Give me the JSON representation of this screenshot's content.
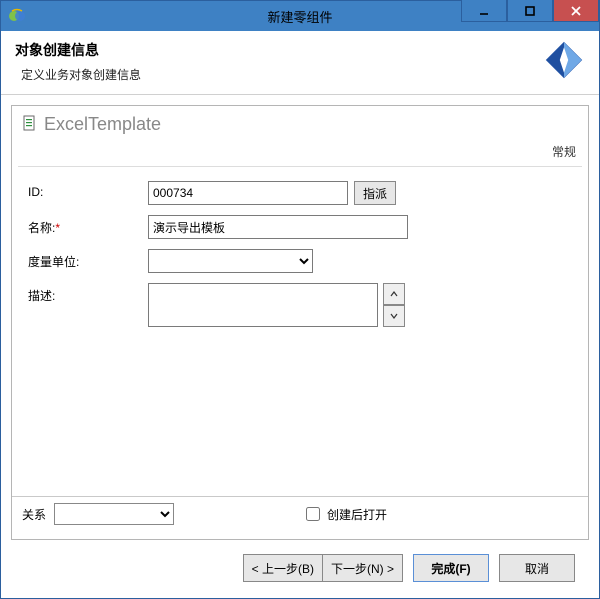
{
  "window": {
    "title": "新建零组件"
  },
  "header": {
    "title": "对象创建信息",
    "subtitle": "定义业务对象创建信息"
  },
  "panel": {
    "title": "ExcelTemplate",
    "tab": "常规"
  },
  "form": {
    "id": {
      "label": "ID:",
      "value": "000734",
      "assign_btn": "指派"
    },
    "name": {
      "label": "名称:",
      "value": "演示导出模板"
    },
    "unit": {
      "label": "度量单位:",
      "value": ""
    },
    "desc": {
      "label": "描述:",
      "value": ""
    }
  },
  "relation": {
    "label": "关系",
    "selected": "",
    "open_after_create_label": "创建后打开",
    "open_after_create_checked": false
  },
  "footer": {
    "back": "< 上一步(B)",
    "next": "下一步(N) >",
    "finish": "完成(F)",
    "cancel": "取消"
  }
}
